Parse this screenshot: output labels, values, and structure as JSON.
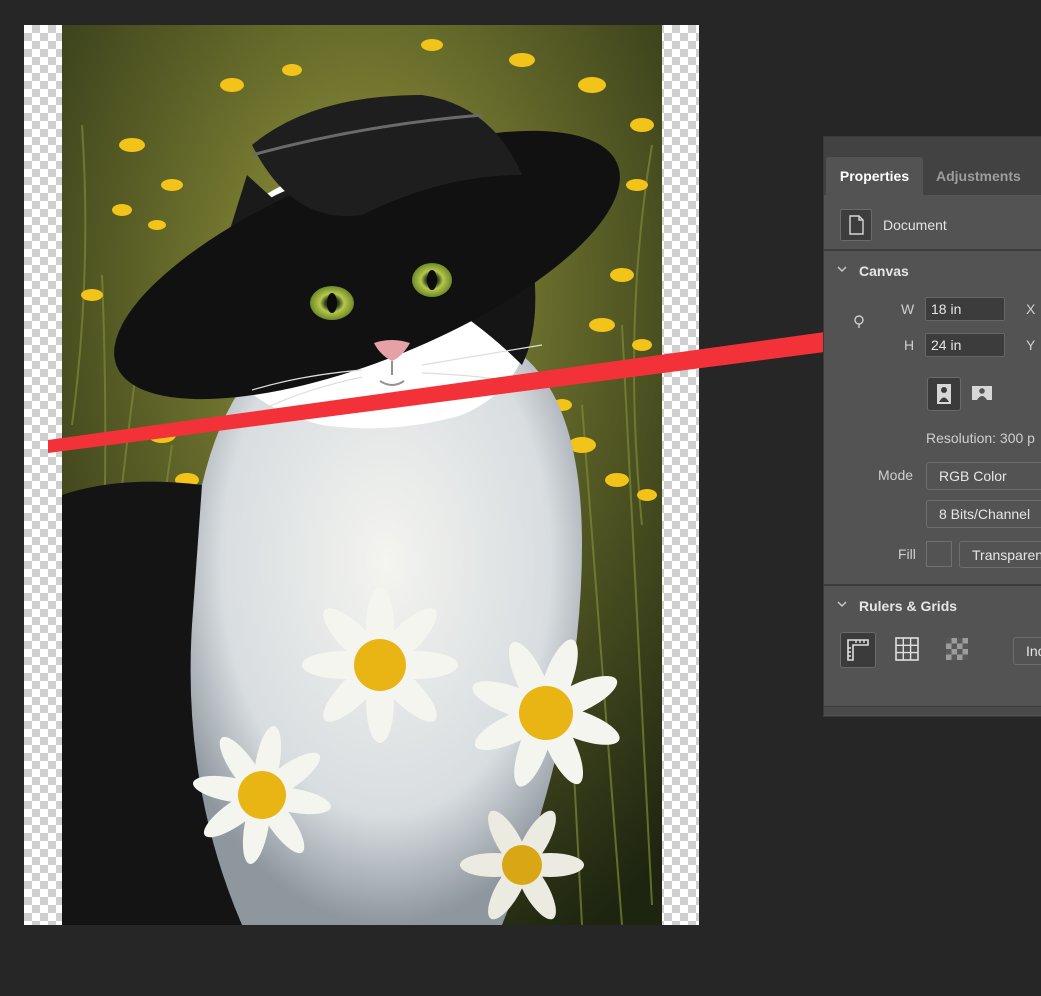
{
  "panel": {
    "tabs": [
      {
        "label": "Properties"
      },
      {
        "label": "Adjustments"
      }
    ],
    "document_label": "Document",
    "canvas": {
      "title": "Canvas",
      "width_label": "W",
      "width_value": "18 in",
      "height_label": "H",
      "height_value": "24 in",
      "x_label": "X",
      "y_label": "Y",
      "resolution": "Resolution: 300 p",
      "mode_label": "Mode",
      "mode_value": "RGB Color",
      "bits_value": "8 Bits/Channel",
      "fill_label": "Fill",
      "fill_value": "Transparen"
    },
    "rulers": {
      "title": "Rulers & Grids",
      "units_value": "Inc"
    }
  },
  "colors": {
    "app_background": "#262626",
    "panel_background": "#535353",
    "annotation_arrow": "#f23238"
  },
  "icons": [
    "document-icon",
    "chevron-down-icon",
    "link-icon",
    "portrait-icon",
    "landscape-icon",
    "ruler-icon",
    "grid-icon",
    "pixel-grid-icon"
  ]
}
